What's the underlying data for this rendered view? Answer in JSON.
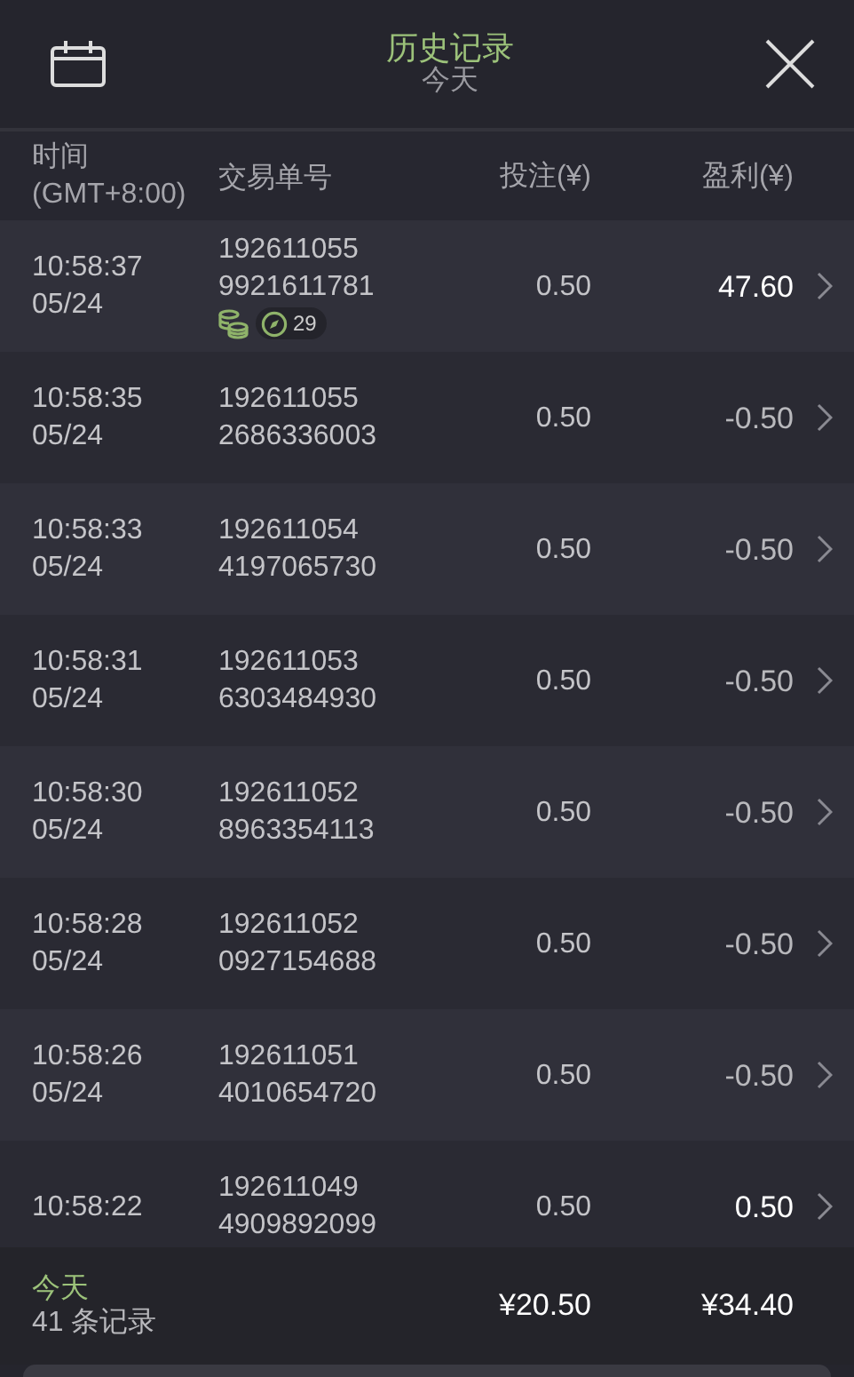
{
  "header": {
    "title": "历史记录",
    "subtitle": "今天"
  },
  "columns": [
    "时间\n(GMT+8:00)",
    "交易单号",
    "投注(¥)",
    "盈利(¥)"
  ],
  "rows": [
    {
      "time": "10:58:37",
      "date": "05/24",
      "order": "192611055\n9921611781",
      "stake": "0.50",
      "profit": "47.60",
      "win": true,
      "badge": "29"
    },
    {
      "time": "10:58:35",
      "date": "05/24",
      "order": "192611055\n2686336003",
      "stake": "0.50",
      "profit": "-0.50",
      "win": false
    },
    {
      "time": "10:58:33",
      "date": "05/24",
      "order": "192611054\n4197065730",
      "stake": "0.50",
      "profit": "-0.50",
      "win": false
    },
    {
      "time": "10:58:31",
      "date": "05/24",
      "order": "192611053\n6303484930",
      "stake": "0.50",
      "profit": "-0.50",
      "win": false
    },
    {
      "time": "10:58:30",
      "date": "05/24",
      "order": "192611052\n8963354113",
      "stake": "0.50",
      "profit": "-0.50",
      "win": false
    },
    {
      "time": "10:58:28",
      "date": "05/24",
      "order": "192611052\n0927154688",
      "stake": "0.50",
      "profit": "-0.50",
      "win": false
    },
    {
      "time": "10:58:26",
      "date": "05/24",
      "order": "192611051\n4010654720",
      "stake": "0.50",
      "profit": "-0.50",
      "win": false
    },
    {
      "time": "10:58:22",
      "order": "192611049\n4909892099",
      "stake": "0.50",
      "profit": "0.50",
      "win": true
    }
  ],
  "footer": {
    "period": "今天",
    "count": "41 条记录",
    "total_stake": "¥20.50",
    "total_profit": "¥34.40"
  }
}
